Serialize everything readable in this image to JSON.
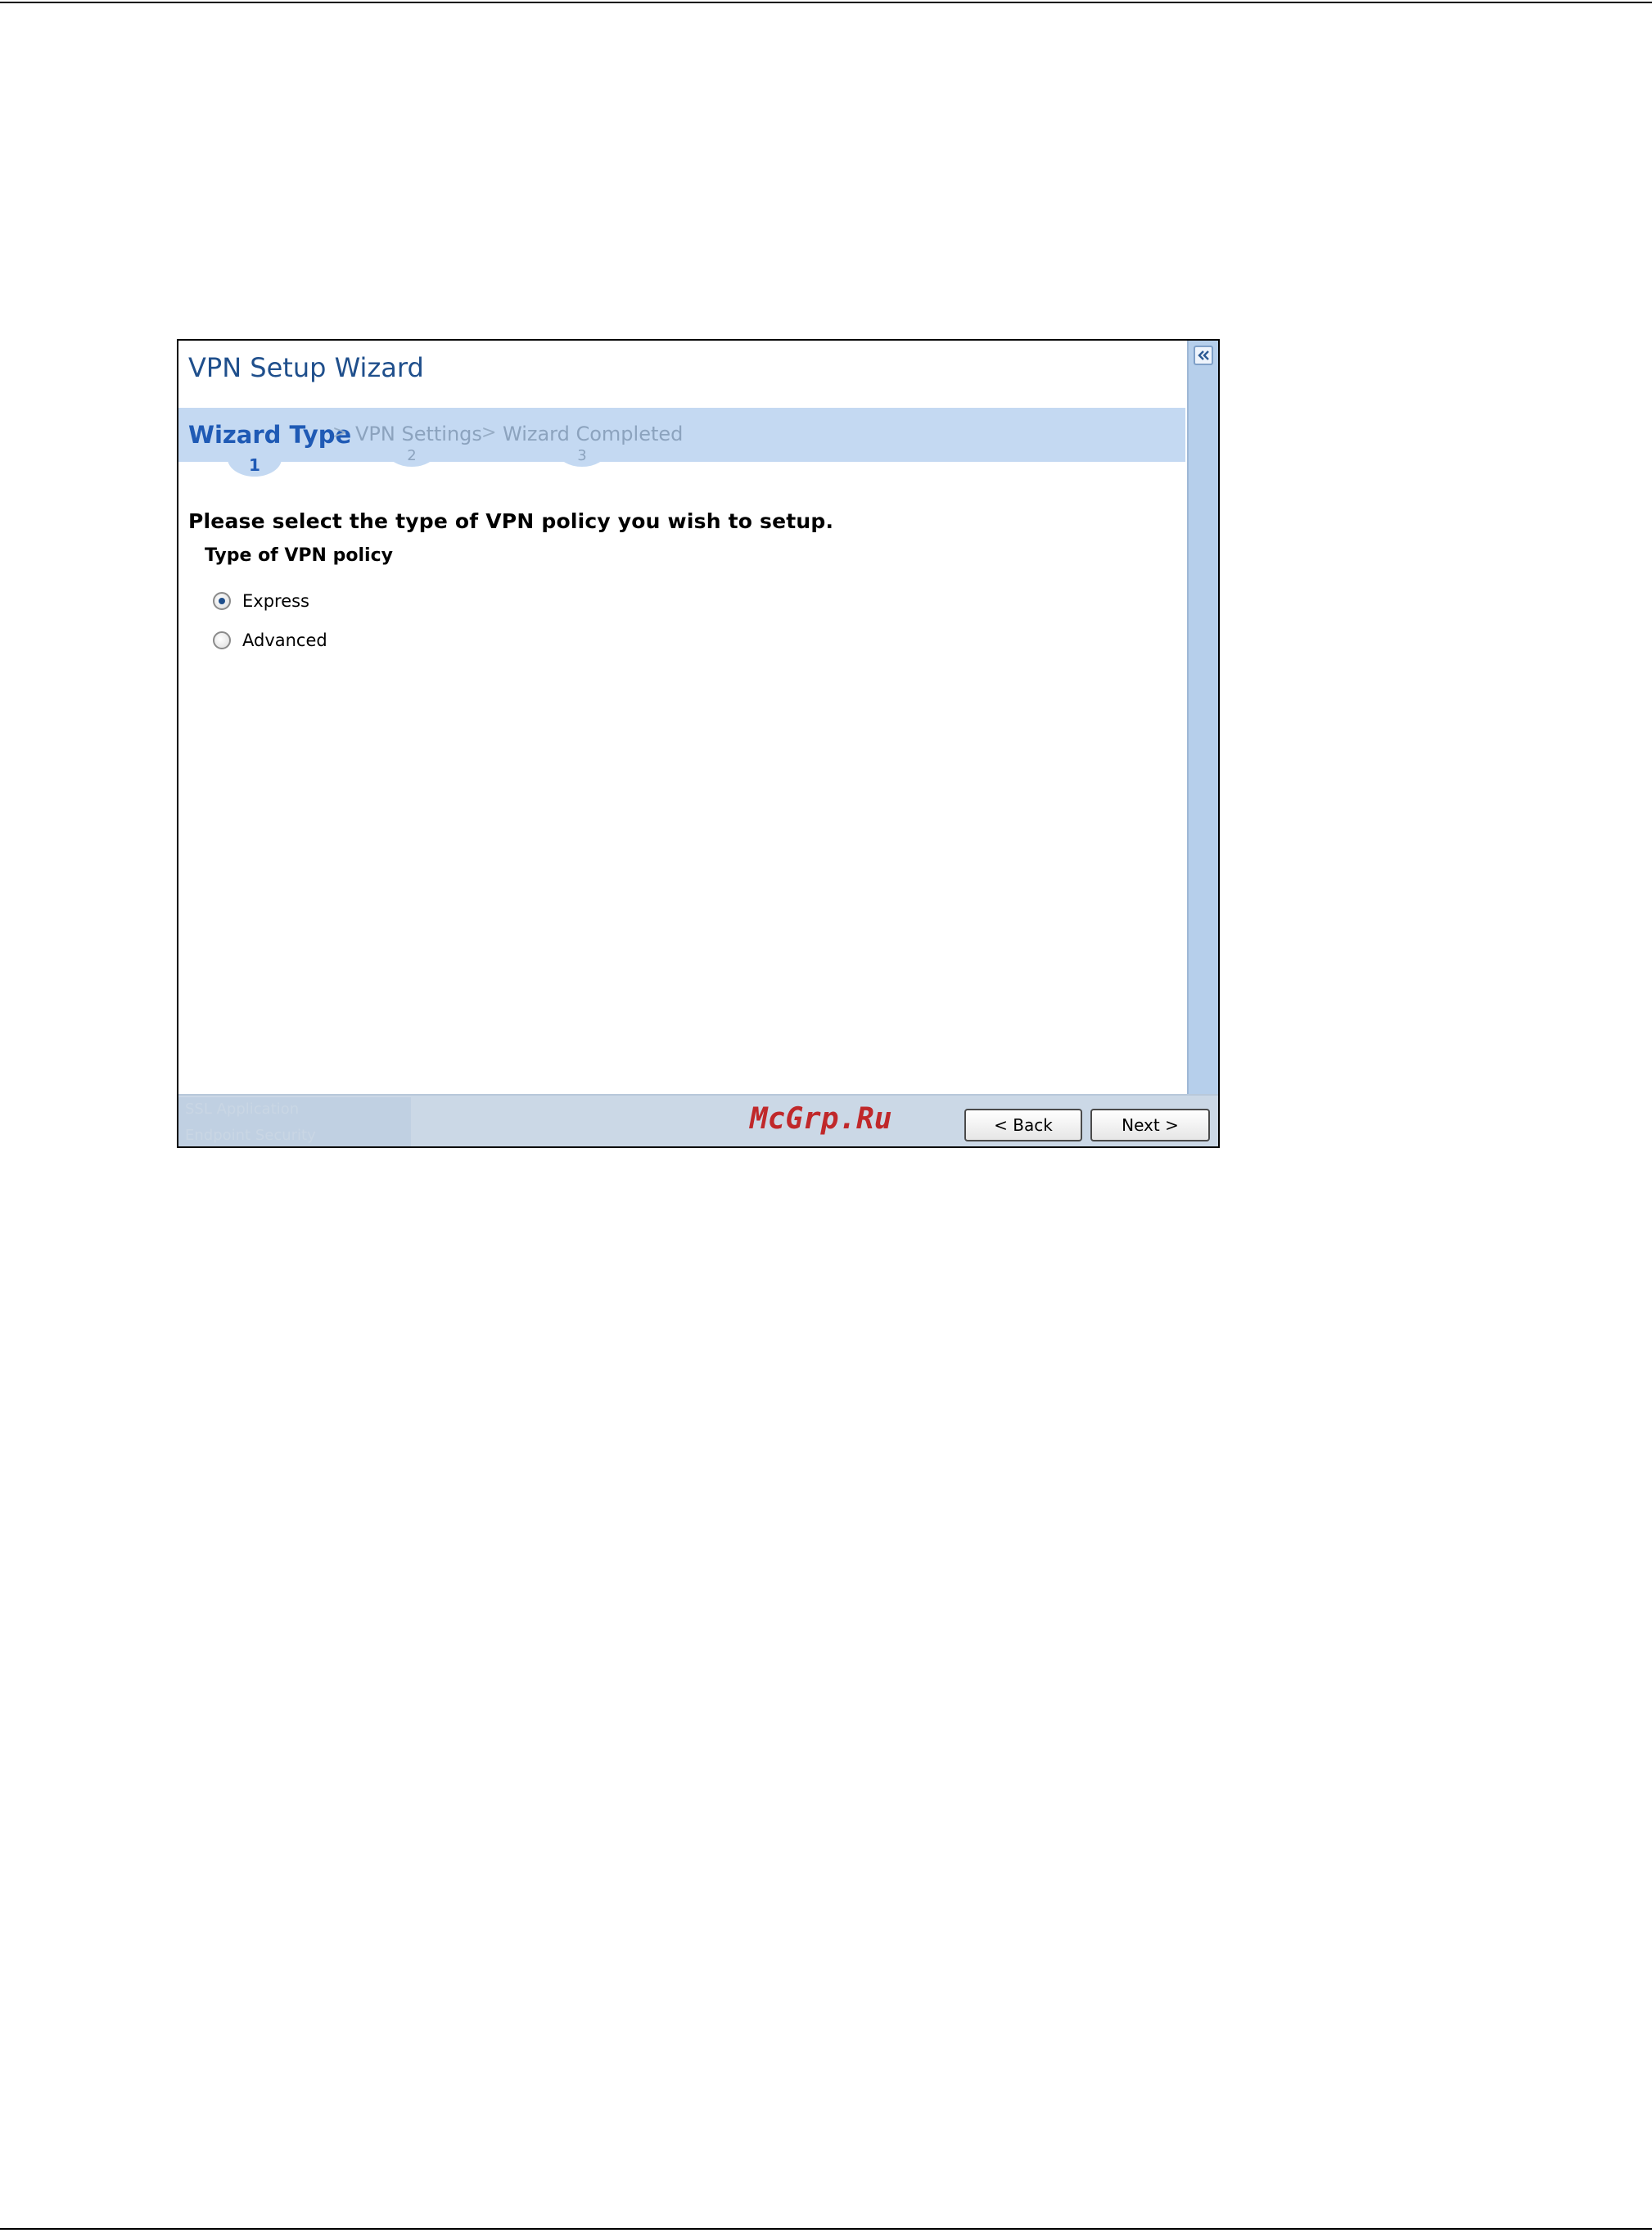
{
  "wizard": {
    "title": "VPN Setup Wizard",
    "steps": [
      {
        "label": "Wizard Type",
        "number": "1"
      },
      {
        "label": "VPN Settings",
        "number": "2"
      },
      {
        "label": "Wizard Completed",
        "number": "3"
      }
    ],
    "step_separator": ">",
    "current_step": 1
  },
  "main": {
    "prompt": "Please select the type of VPN policy you wish to setup.",
    "section_label": "Type of VPN policy",
    "options": [
      {
        "label": "Express",
        "selected": true
      },
      {
        "label": "Advanced",
        "selected": false
      }
    ]
  },
  "footer": {
    "watermark": "McGrp.Ru",
    "back_label": "< Back",
    "next_label": "Next >",
    "ghost_lines": [
      "SSL Application",
      "Endpoint Security"
    ]
  },
  "icons": {
    "collapse": "double-chevron-left-icon"
  },
  "colors": {
    "title": "#1f4f8c",
    "steps_bar": "#c4d9f2",
    "active_step": "#1f5ab5",
    "inactive_step": "#8ca3be",
    "side_strip": "#b6cfeb",
    "watermark": "#c0282a"
  }
}
